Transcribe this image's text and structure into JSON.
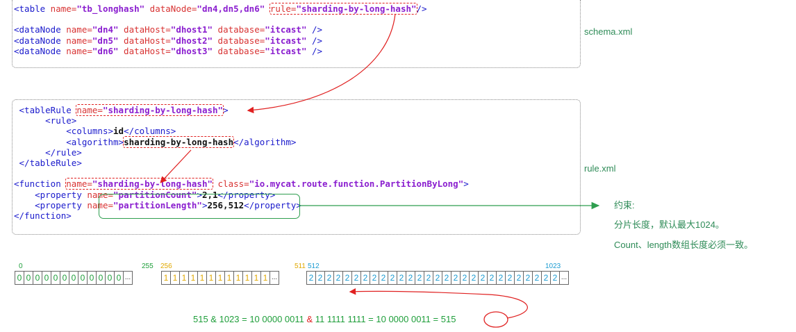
{
  "schema": {
    "label": "schema.xml",
    "table": {
      "open": "<table",
      "name_attr": " name=",
      "name_value": "\"tb_longhash\"",
      "datanode_attr": " dataNode=",
      "datanode_value": "\"dn4,dn5,dn6\"",
      "rule_attr": "rule=",
      "rule_value": "\"sharding-by-long-hash\"",
      "close": "/>"
    },
    "datanodes": [
      {
        "name": "\"dn4\"",
        "host": "\"dhost1\"",
        "db": "\"itcast\""
      },
      {
        "name": "\"dn5\"",
        "host": "\"dhost2\"",
        "db": "\"itcast\""
      },
      {
        "name": "\"dn6\"",
        "host": "\"dhost3\"",
        "db": "\"itcast\""
      }
    ],
    "datanode_tag": "<dataNode",
    "name_attr": " name=",
    "host_attr": " dataHost=",
    "db_attr": " database=",
    "end": " />"
  },
  "rule": {
    "label": "rule.xml",
    "tablerule_open": "<tableRule",
    "tablerule_name_attr": "name=",
    "tablerule_name_value": "\"sharding-by-long-hash\"",
    "gt": ">",
    "rule_open": "<rule>",
    "columns_open": "<columns>",
    "columns_value": "id",
    "columns_close": "</columns>",
    "algorithm_open": "<algorithm>",
    "algorithm_value": "sharding-by-long-hash",
    "algorithm_close": "</algorithm>",
    "rule_close": "</rule>",
    "tablerule_close": "</tableRule>",
    "function_open": "<function",
    "function_name_attr": "name=",
    "function_name_value": "\"sharding-by-long-hash\"",
    "class_attr": " class=",
    "class_value": "\"io.mycat.route.function.PartitionByLong\"",
    "property_open": "<property",
    "prop1_name_attr": "name=",
    "prop1_name_value": "\"partitionCount\"",
    "prop1_value": "2,1",
    "prop2_name_attr": "name=",
    "prop2_name_value": "\"partitionLength\"",
    "prop2_value": "256,512",
    "property_close": "</property>",
    "function_close": "</function>"
  },
  "notes": {
    "title": "约束:",
    "line1": "分片长度，默认最大1024。",
    "line2": "Count、length数组长度必须一致。"
  },
  "indices": {
    "i0": "0",
    "i255": "255",
    "i256": "256",
    "i511": "511",
    "i512": "512",
    "i1023": "1023"
  },
  "cells": {
    "group0": [
      "0",
      "0",
      "0",
      "0",
      "0",
      "0",
      "0",
      "0",
      "0",
      "0",
      "0",
      "0",
      "..."
    ],
    "group1": [
      "1",
      "1",
      "1",
      "1",
      "1",
      "1",
      "1",
      "1",
      "1",
      "1",
      "1",
      "1",
      "..."
    ],
    "group2": [
      "2",
      "2",
      "2",
      "2",
      "2",
      "2",
      "2",
      "2",
      "2",
      "2",
      "2",
      "2",
      "2",
      "2",
      "2",
      "2",
      "2",
      "2",
      "2",
      "2",
      "2",
      "2",
      "2",
      "2",
      "2",
      "2",
      "2",
      "2",
      "..."
    ]
  },
  "formula": {
    "left": "515 & 1023 = 10 0000 0011 ",
    "amp": "&",
    "right": " 11 1111 1111 = 10 0000 0011 = ",
    "result": "515"
  },
  "colors": {
    "tag": "#1a1acc",
    "attr": "#d83333",
    "value": "#8a1ecf",
    "green": "#1e9e3a",
    "yellow": "#e0a800",
    "blue": "#1a9bd1",
    "red_arrow": "#e02020"
  }
}
